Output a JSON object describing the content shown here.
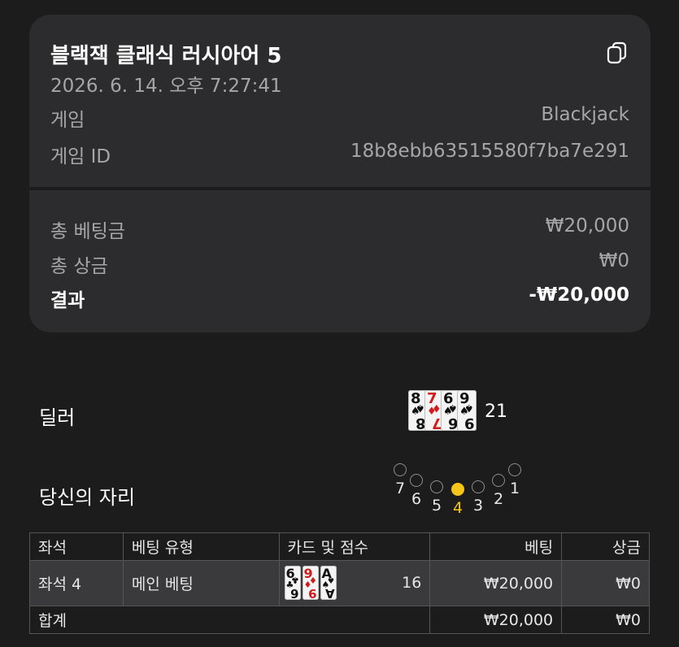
{
  "summary": {
    "title": "블랙잭 클래식 러시아어 5",
    "datetime": "2026. 6. 14. 오후 7:27:41",
    "game_label": "게임",
    "game_value": "Blackjack",
    "game_id_label": "게임 ID",
    "game_id_value": "18b8ebb63515580f7ba7e291",
    "total_bet_label": "총 베팅금",
    "total_bet_value": "₩20,000",
    "total_win_label": "총 상금",
    "total_win_value": "₩0",
    "result_label": "결과",
    "result_value": "-₩20,000",
    "copy_icon": "copy-icon"
  },
  "dealer": {
    "label": "딜러",
    "score": "21",
    "cards": [
      {
        "rank": "8",
        "suit": "♠",
        "color": "#111111"
      },
      {
        "rank": "7",
        "suit": "♦",
        "color": "#d01c1c"
      },
      {
        "rank": "6",
        "suit": "♠",
        "color": "#111111"
      },
      {
        "rank": "9",
        "suit": "♠",
        "color": "#111111"
      }
    ]
  },
  "seats": {
    "label": "당신의 자리",
    "active_seat": "4",
    "active_color": "#f5c518",
    "list": [
      "7",
      "6",
      "5",
      "4",
      "3",
      "2",
      "1"
    ]
  },
  "table": {
    "headers": {
      "seat": "좌석",
      "bet_type": "베팅 유형",
      "cards_score": "카드 및 점수",
      "bet": "베팅",
      "win": "상금"
    },
    "row": {
      "seat": "좌석 4",
      "bet_type": "메인 베팅",
      "score": "16",
      "bet": "₩20,000",
      "win": "₩0",
      "cards": [
        {
          "rank": "6",
          "suit": "♣",
          "color": "#111111"
        },
        {
          "rank": "9",
          "suit": "♦",
          "color": "#d01c1c"
        },
        {
          "rank": "A",
          "suit": "♠",
          "color": "#111111"
        }
      ]
    },
    "total": {
      "label": "합계",
      "bet": "₩20,000",
      "win": "₩0"
    }
  }
}
